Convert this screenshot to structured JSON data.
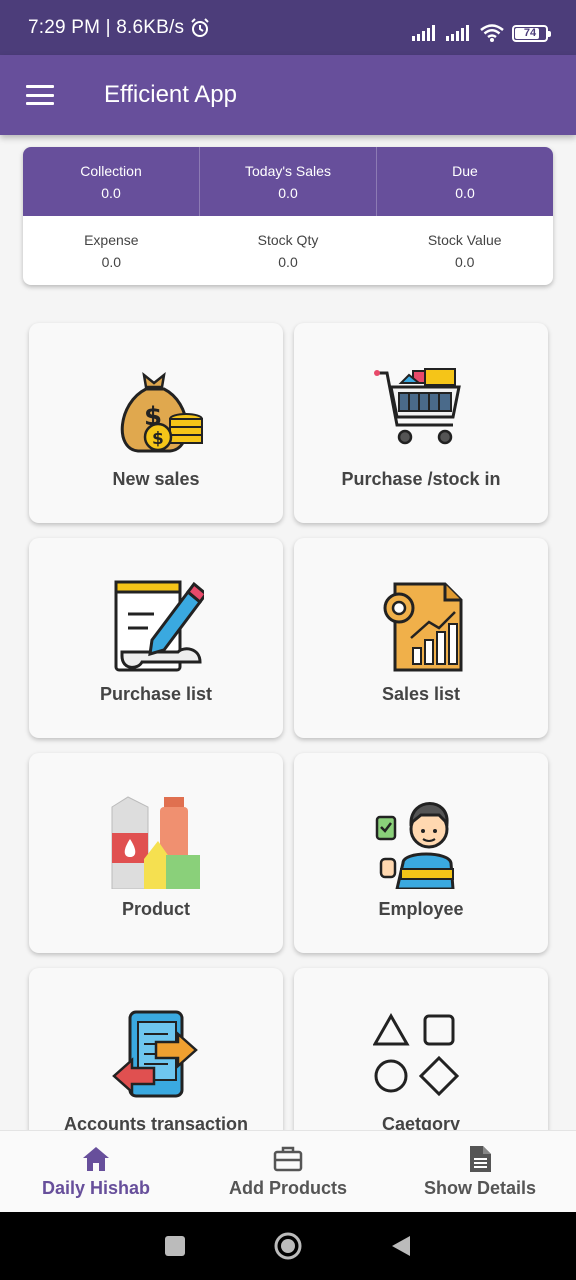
{
  "status_bar": {
    "time": "7:29 PM | 8.6KB/s",
    "battery": "74"
  },
  "app_bar": {
    "title": "Efficient App",
    "menu_icon": "hamburger-menu-icon"
  },
  "summary": {
    "top": [
      {
        "label": "Collection",
        "value": "0.0"
      },
      {
        "label": "Today's Sales",
        "value": "0.0"
      },
      {
        "label": "Due",
        "value": "0.0"
      }
    ],
    "bottom": [
      {
        "label": "Expense",
        "value": "0.0"
      },
      {
        "label": "Stock Qty",
        "value": "0.0"
      },
      {
        "label": "Stock Value",
        "value": "0.0"
      }
    ]
  },
  "tiles": [
    {
      "label": "New sales",
      "icon": "money-bag-icon"
    },
    {
      "label": "Purchase /stock in",
      "icon": "shopping-cart-icon"
    },
    {
      "label": "Purchase list",
      "icon": "notepad-pencil-icon"
    },
    {
      "label": "Sales list",
      "icon": "report-chart-icon"
    },
    {
      "label": "Product",
      "icon": "groceries-icon"
    },
    {
      "label": "Employee",
      "icon": "employee-icon"
    },
    {
      "label": "Accounts transaction",
      "icon": "transaction-icon"
    },
    {
      "label": "Caetgory",
      "icon": "shapes-icon"
    }
  ],
  "bottom_nav": [
    {
      "label": "Daily Hishab",
      "icon": "home-icon",
      "active": true
    },
    {
      "label": "Add Products",
      "icon": "briefcase-icon",
      "active": false
    },
    {
      "label": "Show Details",
      "icon": "document-icon",
      "active": false
    }
  ],
  "colors": {
    "primary": "#674f9b",
    "status_bar": "#4c3d7a",
    "background": "#f5f5f5"
  }
}
